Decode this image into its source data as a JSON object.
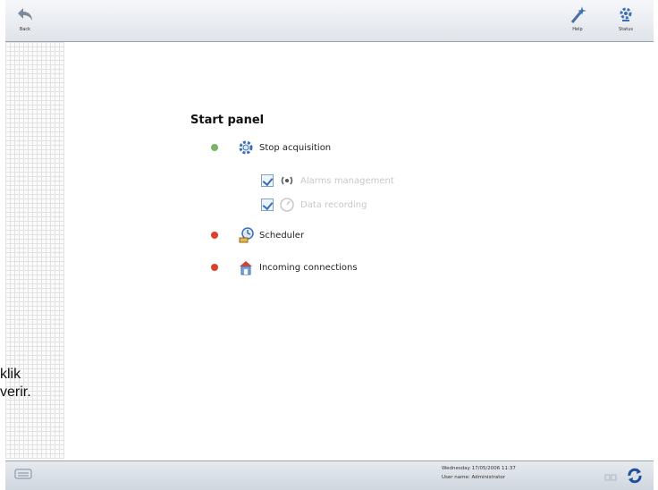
{
  "toolbar": {
    "back_label": "Back",
    "help_label": "Help",
    "status_label": "Status"
  },
  "panel": {
    "title": "Start panel",
    "items": [
      {
        "label": "Stop acquisition",
        "status_color": "#7ab36a",
        "enabled": true
      },
      {
        "label": "Alarms management",
        "enabled": false,
        "checked": true
      },
      {
        "label": "Data recording",
        "enabled": false,
        "checked": true
      },
      {
        "label": "Scheduler",
        "status_color": "#d9432c",
        "enabled": true
      },
      {
        "label": "Incoming connections",
        "status_color": "#d9432c",
        "enabled": true
      }
    ]
  },
  "overlay": {
    "line1": "klik",
    "line2": "verir."
  },
  "statusbar": {
    "date_line": "Wednesday   17/05/2006   11:37",
    "user_line": "User name:  Administrator"
  },
  "colors": {
    "accent": "#3c6fb3",
    "green_status": "#7ab36a",
    "red_status": "#d9432c"
  }
}
